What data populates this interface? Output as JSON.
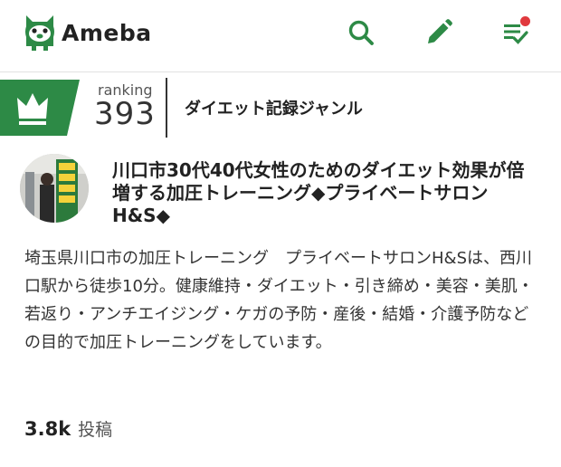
{
  "header": {
    "logo_text": "Ameba",
    "search_icon": "search-icon",
    "write_icon": "pencil-icon",
    "feed_icon": "checklist-icon",
    "brand_color": "#2d8a46",
    "notification_color": "#e0393e"
  },
  "ranking": {
    "label": "ranking",
    "number": "393",
    "genre": "ダイエット記録ジャンル",
    "badge_icon": "crown-icon"
  },
  "blog": {
    "title": "川口市30代40代女性のためのダイエット効果が倍増する加圧トレーニング◆プライベートサロンH&S◆",
    "description": "埼玉県川口市の加圧トレーニング　プライベートサロンH&Sは、西川口駅から徒歩10分。健康維持・ダイエット・引き締め・美容・美肌・若返り・アンチエイジング・ケガの予防・産後・結婚・介護予防などの目的で加圧トレーニングをしています。",
    "post_count": "3.8k",
    "post_label": "投稿"
  }
}
